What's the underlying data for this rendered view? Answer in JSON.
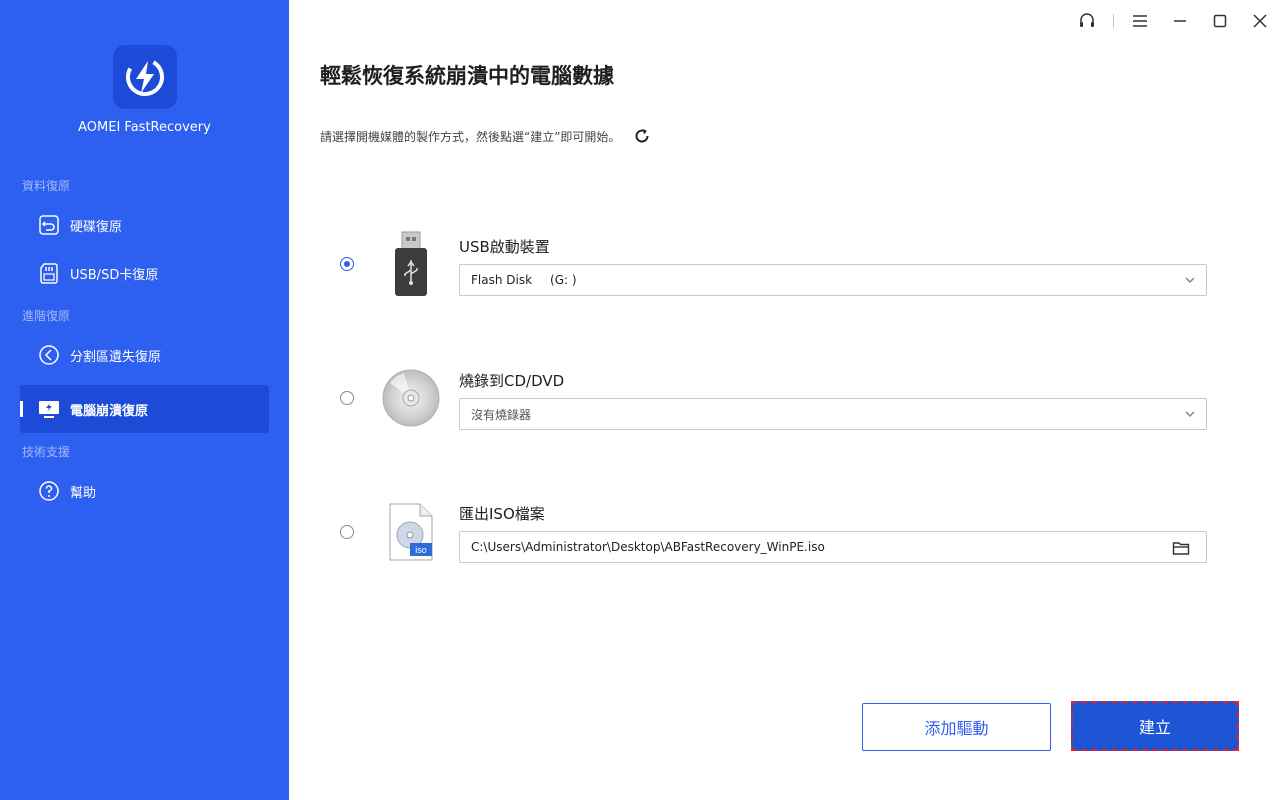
{
  "app": {
    "name": "AOMEI FastRecovery"
  },
  "sidebar": {
    "sections": [
      {
        "label": "資料復原"
      },
      {
        "label": "進階復原"
      },
      {
        "label": "技術支援"
      }
    ],
    "items": [
      {
        "label": "硬碟復原",
        "icon": "disk-restore-icon",
        "active": false
      },
      {
        "label": "USB/SD卡復原",
        "icon": "sd-card-icon",
        "active": false
      },
      {
        "label": "分割區遺失復原",
        "icon": "partition-restore-icon",
        "active": false
      },
      {
        "label": "電腦崩潰復原",
        "icon": "computer-crash-icon",
        "active": true
      },
      {
        "label": "幫助",
        "icon": "help-icon",
        "active": false
      }
    ]
  },
  "window_controls": {
    "icons": [
      "headset-icon",
      "menu-icon",
      "minimize-icon",
      "maximize-icon",
      "close-icon"
    ]
  },
  "main": {
    "title": "輕鬆恢復系統崩潰中的電腦數據",
    "subtitle": "請選擇開機媒體的製作方式，然後點選“建立”即可開始。",
    "options": [
      {
        "title": "USB啟動裝置",
        "selected": true,
        "field_name": "Flash Disk",
        "field_drive": "(G: )",
        "icon": "usb-drive-icon"
      },
      {
        "title": "燒錄到CD/DVD",
        "selected": false,
        "field_value": "沒有燒錄器",
        "icon": "disc-icon"
      },
      {
        "title": "匯出ISO檔案",
        "selected": false,
        "field_value": "C:\\Users\\Administrator\\Desktop\\ABFastRecovery_WinPE.iso",
        "icon": "iso-file-icon",
        "badge": "iso"
      }
    ],
    "buttons": {
      "add_driver": "添加驅動",
      "create": "建立"
    }
  },
  "colors": {
    "sidebar_bg": "#2d5ff0",
    "active_item_bg": "#1d4bd8",
    "primary_button": "#1d55d4",
    "focus_outline": "#e0232d"
  }
}
